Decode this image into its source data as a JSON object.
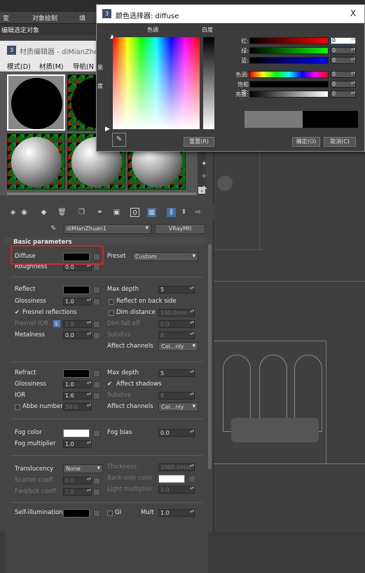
{
  "viewport": {
    "tab1": "变",
    "tab2": "对象绘制",
    "tab3": "填",
    "edit_selected": "编辑选定对象"
  },
  "material_editor": {
    "title": "材质编辑器 - diMianZhe",
    "menu": [
      "模式(D)",
      "材质(M)",
      "导航(N"
    ],
    "material_name": "diMianZhuan1",
    "material_type": "VRayMtl",
    "section_title": "Basic parameters",
    "diffuse": {
      "label": "Diffuse",
      "color": "#000000"
    },
    "preset": {
      "label": "Preset",
      "value": "Custom"
    },
    "roughness": {
      "label": "Roughness",
      "value": "0.0"
    },
    "reflect": {
      "label": "Reflect",
      "color": "#000000"
    },
    "glossiness": {
      "label": "Glossiness",
      "value": "1.0"
    },
    "fresnel": {
      "label": "Fresnel reflections",
      "checked": true
    },
    "fresnel_ior": {
      "label": "Fresnel IOR",
      "lock": "L",
      "value": "1.6"
    },
    "metalness": {
      "label": "Metalness",
      "value": "0.0"
    },
    "max_depth": {
      "label": "Max depth",
      "value": "5"
    },
    "reflect_back": {
      "label": "Reflect on back side"
    },
    "dim_distance": {
      "label": "Dim distance",
      "value": "100.0mm"
    },
    "dim_falloff": {
      "label": "Dim fall off",
      "value": "0.0"
    },
    "subdivs": {
      "label": "Subdivs",
      "value": "8"
    },
    "affect_channels": {
      "label": "Affect channels",
      "value": "Col...nly"
    },
    "refract": {
      "label": "Refract",
      "color": "#000000"
    },
    "refr_glossiness": {
      "label": "Glossiness",
      "value": "1.0"
    },
    "ior": {
      "label": "IOR",
      "value": "1.6"
    },
    "abbe": {
      "label": "Abbe number",
      "value": "50.0"
    },
    "refr_max_depth": {
      "label": "Max depth",
      "value": "5"
    },
    "affect_shadows": {
      "label": "Affect shadows",
      "checked": true
    },
    "refr_subdivs": {
      "label": "Subdivs",
      "value": "8"
    },
    "refr_affect_channels": {
      "label": "Affect channels",
      "value": "Col...nly"
    },
    "fog_color": {
      "label": "Fog color",
      "color": "#ffffff"
    },
    "fog_bias": {
      "label": "Fog bias",
      "value": "0.0"
    },
    "fog_multiplier": {
      "label": "Fog multiplier",
      "value": "1.0"
    },
    "translucency": {
      "label": "Translucency",
      "value": "None"
    },
    "thickness": {
      "label": "Thickness",
      "value": "1000.0mm"
    },
    "scatter_coeff": {
      "label": "Scatter coeff",
      "value": "0.0"
    },
    "backside_color": {
      "label": "Back-side color",
      "color": "#ffffff"
    },
    "fwd_bck": {
      "label": "Fwd/bck coeff",
      "value": "1.0"
    },
    "light_multiplier": {
      "label": "Light multiplier",
      "value": "1.0"
    },
    "self_illum": {
      "label": "Self-illumination",
      "color": "#000000"
    },
    "gi": {
      "label": "GI"
    },
    "mult": {
      "label": "Mult",
      "value": "1.0"
    }
  },
  "color_selector": {
    "title": "颜色选择器: diffuse",
    "hue_label": "色调",
    "white_label": "白度",
    "black_label": "黑",
    "degree_label": "度",
    "red": {
      "label": "红:",
      "value": "0"
    },
    "green": {
      "label": "绿:",
      "value": "0"
    },
    "blue": {
      "label": "蓝:",
      "value": "0"
    },
    "hue": {
      "label": "色调:",
      "value": "0"
    },
    "saturation": {
      "label": "饱和度:",
      "value": "0"
    },
    "brightness": {
      "label": "亮度:",
      "value": "0"
    },
    "reset": "重置(R)",
    "ok": "确定(O)",
    "cancel": "取消(C)",
    "close": "X"
  }
}
